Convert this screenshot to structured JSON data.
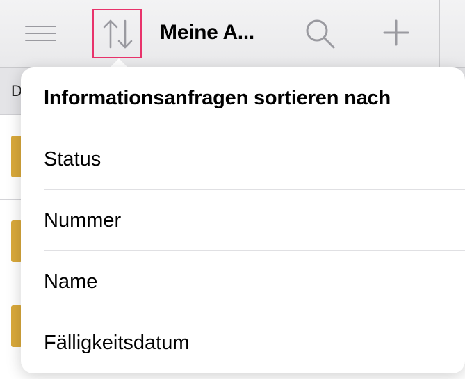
{
  "toolbar": {
    "title": "Meine A...",
    "icons": {
      "menu": "hamburger-menu-icon",
      "sort": "sort-arrows-icon",
      "search": "search-icon",
      "add": "plus-icon"
    },
    "highlight_color": "#e8336b",
    "icon_color": "#9a9aa0"
  },
  "background_list": {
    "header_text": "D",
    "marker_color": "#d9a93b",
    "rows": 3
  },
  "sort_popover": {
    "title": "Informationsanfragen sortieren nach",
    "options": [
      {
        "label": "Status"
      },
      {
        "label": "Nummer"
      },
      {
        "label": "Name"
      },
      {
        "label": "Fälligkeitsdatum"
      }
    ]
  }
}
